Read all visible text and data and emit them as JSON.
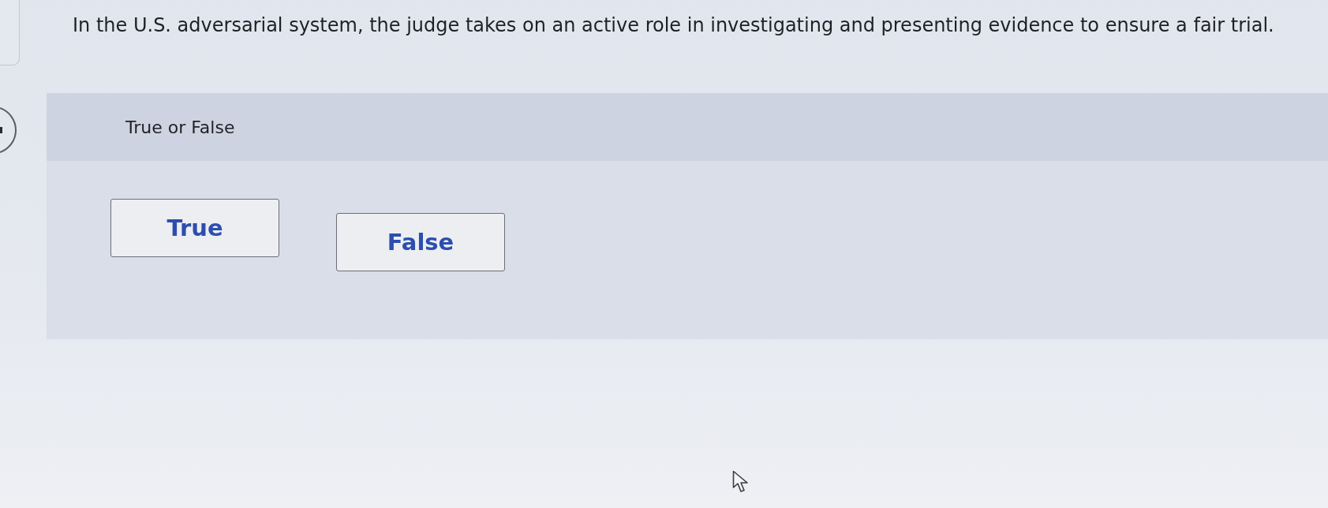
{
  "question": {
    "text": "In the U.S. adversarial system, the judge takes on an active role in investigating and presenting evidence to ensure a fair trial."
  },
  "answer_panel": {
    "prompt": "True or False",
    "options": [
      {
        "label": "True",
        "selected": false
      },
      {
        "label": "False",
        "selected": false
      }
    ]
  }
}
